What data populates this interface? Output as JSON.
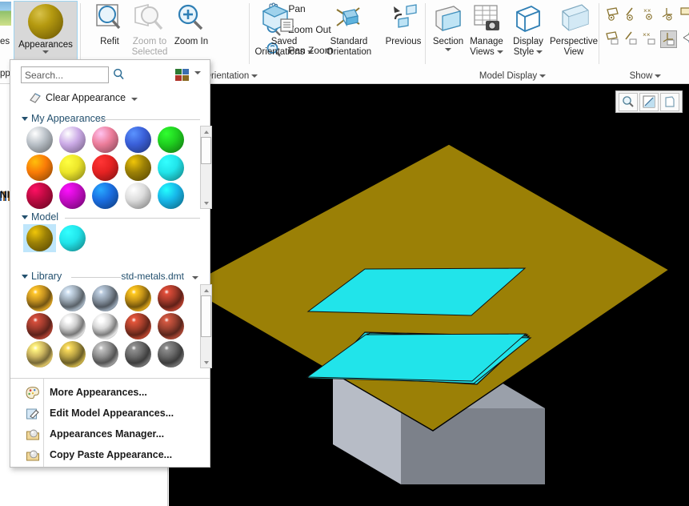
{
  "ribbon": {
    "appearances": {
      "label": "Appearances",
      "icon": "sphere-gold-icon"
    },
    "left_tab_text": "es",
    "left_tab_text2": "pp",
    "left_tree_text": "NI",
    "groups": [
      {
        "name": "orientation",
        "label": "Orientation",
        "buttons": [
          {
            "label": "Refit",
            "icon": "refit-magnifier-icon",
            "disabled": false
          },
          {
            "label": "Zoom to Selected",
            "icon": "zoom-to-selected-icon",
            "disabled": true
          },
          {
            "label": "Zoom In",
            "icon": "zoom-in-icon",
            "disabled": false
          },
          {
            "label": "Pan",
            "icon": "pan-hand-icon",
            "disabled": false
          },
          {
            "label": "Zoom Out",
            "icon": "zoom-out-icon",
            "disabled": false
          },
          {
            "label": "Pan Zoom",
            "icon": "pan-zoom-icon",
            "disabled": false
          },
          {
            "label": "Saved Orientations",
            "icon": "saved-orientations-icon",
            "disabled": false
          },
          {
            "label": "Standard Orientation",
            "icon": "standard-orientation-icon",
            "disabled": false
          },
          {
            "label": "Previous",
            "icon": "previous-view-icon",
            "disabled": false
          }
        ]
      },
      {
        "name": "model-display",
        "label": "Model Display",
        "buttons": [
          {
            "label": "Section",
            "icon": "section-icon"
          },
          {
            "label": "Manage Views",
            "icon": "manage-views-icon"
          },
          {
            "label": "Display Style",
            "icon": "display-style-icon"
          },
          {
            "label": "Perspective View",
            "icon": "perspective-view-icon"
          }
        ]
      },
      {
        "name": "show",
        "label": "Show",
        "icons_row1": [
          "show-planes-icon",
          "show-axes-icon",
          "show-points-icon",
          "show-csys-icon",
          "show-annotations-icon"
        ],
        "icons_row2": [
          "hide-planes-icon",
          "hide-axes-icon",
          "hide-points-icon",
          "hide-csys-icon",
          "hide-annotations-icon"
        ]
      }
    ]
  },
  "panel": {
    "search": {
      "placeholder": "Search...",
      "value": ""
    },
    "search_icon": "search-magnifier-icon",
    "view_toggle_icon": "view-mode-icon",
    "clear_appearance": {
      "label": "Clear Appearance",
      "icon": "eraser-icon"
    },
    "sections": [
      {
        "name": "my-appearances",
        "title": "My Appearances",
        "swatches": [
          {
            "name": "silver-grey",
            "color": "#b9c0c7"
          },
          {
            "name": "light-purple",
            "color": "#cbaae6"
          },
          {
            "name": "pink",
            "color": "#ec7d9a"
          },
          {
            "name": "royal-blue",
            "color": "#3a5fd8"
          },
          {
            "name": "green",
            "color": "#1fcf1f"
          },
          {
            "name": "orange",
            "color": "#f97b07"
          },
          {
            "name": "yellow",
            "color": "#ece52a"
          },
          {
            "name": "red",
            "color": "#e52222"
          },
          {
            "name": "dark-gold",
            "color": "#9b8006"
          },
          {
            "name": "cyan",
            "color": "#21e4ea"
          },
          {
            "name": "crimson",
            "color": "#ba0a40"
          },
          {
            "name": "magenta",
            "color": "#c40bc4"
          },
          {
            "name": "blue",
            "color": "#1a6de0"
          },
          {
            "name": "white-grey",
            "color": "#dcdcdc"
          },
          {
            "name": "sky-blue",
            "color": "#17b6e8"
          }
        ],
        "selected": -1
      },
      {
        "name": "model",
        "title": "Model",
        "swatches": [
          {
            "name": "model-gold",
            "color": "#9b8006"
          },
          {
            "name": "model-cyan",
            "color": "#21e4ea"
          }
        ],
        "selected": 0
      },
      {
        "name": "library",
        "title": "Library",
        "library_name": "std-metals.dmt",
        "swatches": [
          {
            "name": "gold-metal",
            "color": "#c69320"
          },
          {
            "name": "steel-metal",
            "color": "#9aa7b3"
          },
          {
            "name": "grey-steel-metal",
            "color": "#8b98a6"
          },
          {
            "name": "brass-metal",
            "color": "#c79517"
          },
          {
            "name": "copper-metal",
            "color": "#a5392a"
          },
          {
            "name": "bronze-metal",
            "color": "#9e3a2c"
          },
          {
            "name": "aluminium-metal",
            "color": "#cdcdcd"
          },
          {
            "name": "chrome-metal",
            "color": "#d6d6d6"
          },
          {
            "name": "red-copper-metal",
            "color": "#a83f2b"
          },
          {
            "name": "rust-metal",
            "color": "#9c4130"
          },
          {
            "name": "pale-gold-metal",
            "color": "#cbb45e"
          },
          {
            "name": "olive-gold-metal",
            "color": "#b9a243"
          },
          {
            "name": "dark-silver-metal",
            "color": "#8f8f8f"
          },
          {
            "name": "gunmetal",
            "color": "#6a6a6a"
          },
          {
            "name": "dark-grey-metal",
            "color": "#676767"
          }
        ],
        "selected": -1
      }
    ],
    "menu_items": [
      {
        "name": "more-appearances",
        "label": "More Appearances...",
        "icon": "palette-icon"
      },
      {
        "name": "edit-model-appearances",
        "label": "Edit Model Appearances...",
        "icon": "edit-pencil-icon"
      },
      {
        "name": "appearances-manager",
        "label": "Appearances Manager...",
        "icon": "folder-sphere-icon"
      },
      {
        "name": "copy-paste-appearance",
        "label": "Copy Paste Appearance...",
        "icon": "folder-sphere-icon"
      }
    ]
  },
  "viewport": {
    "background": "#000000",
    "toolbar_icons": [
      "zoom-magnifier-icon",
      "shading-style-icon",
      "render-icon"
    ],
    "model": {
      "plate_color": "#9b8006",
      "pocket_color": "#21e4ea",
      "block_front_color": "#b7bcc6",
      "block_side_color": "#7c818a"
    }
  }
}
